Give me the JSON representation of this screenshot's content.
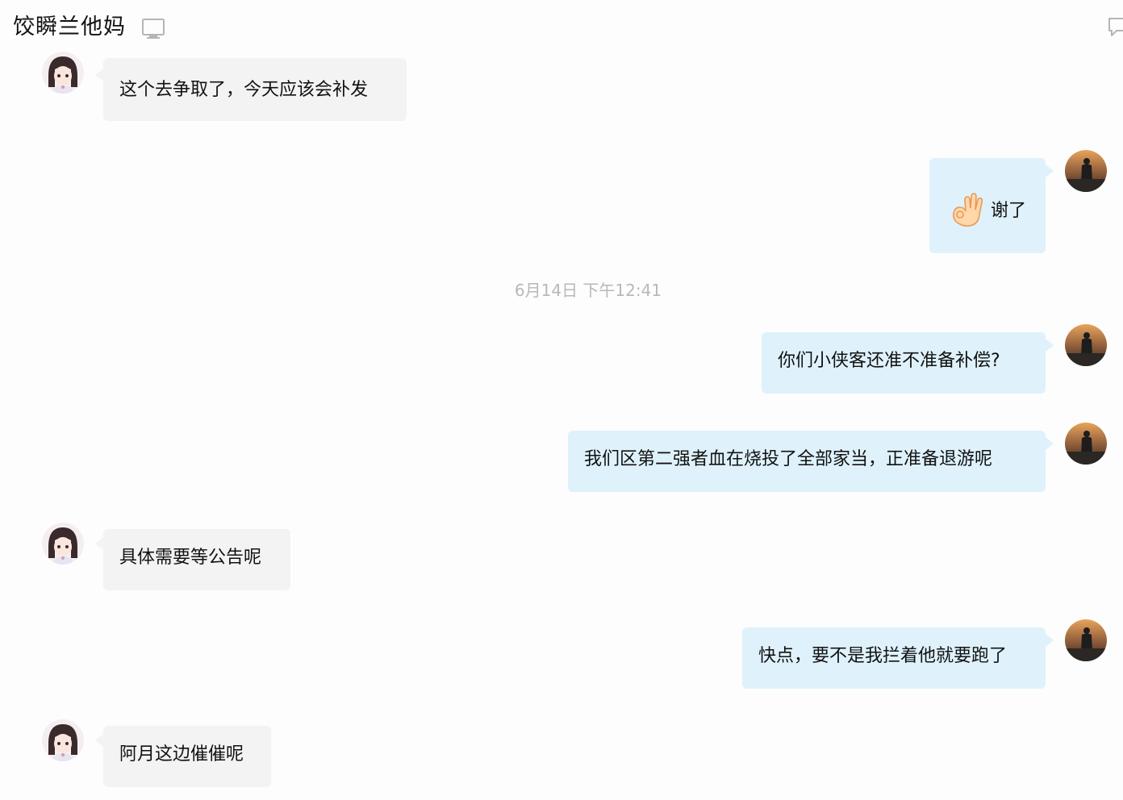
{
  "header": {
    "title": "饺瞬兰他妈",
    "device_icon": "monitor-icon",
    "chat_icon": "chat-bubble-icon"
  },
  "timestamp": "6月14日  下午12:41",
  "messages": [
    {
      "side": "in",
      "text": "这个去争取了，今天应该会补发"
    },
    {
      "side": "out",
      "emoji": "ok-hand-emoji",
      "text": "谢了"
    },
    {
      "side": "out",
      "text": "你们小侠客还准不准备补偿?"
    },
    {
      "side": "out",
      "text": "我们区第二强者血在烧投了全部家当，正准备退游呢"
    },
    {
      "side": "in",
      "text": "具体需要等公告呢"
    },
    {
      "side": "out",
      "text": "快点，要不是我拦着他就要跑了"
    },
    {
      "side": "in",
      "text": "阿月这边催催呢"
    }
  ],
  "colors": {
    "incoming_bubble": "#f3f3f3",
    "outgoing_bubble": "#dff2fc",
    "timestamp_text": "#b8b8b8",
    "text": "#111111"
  }
}
